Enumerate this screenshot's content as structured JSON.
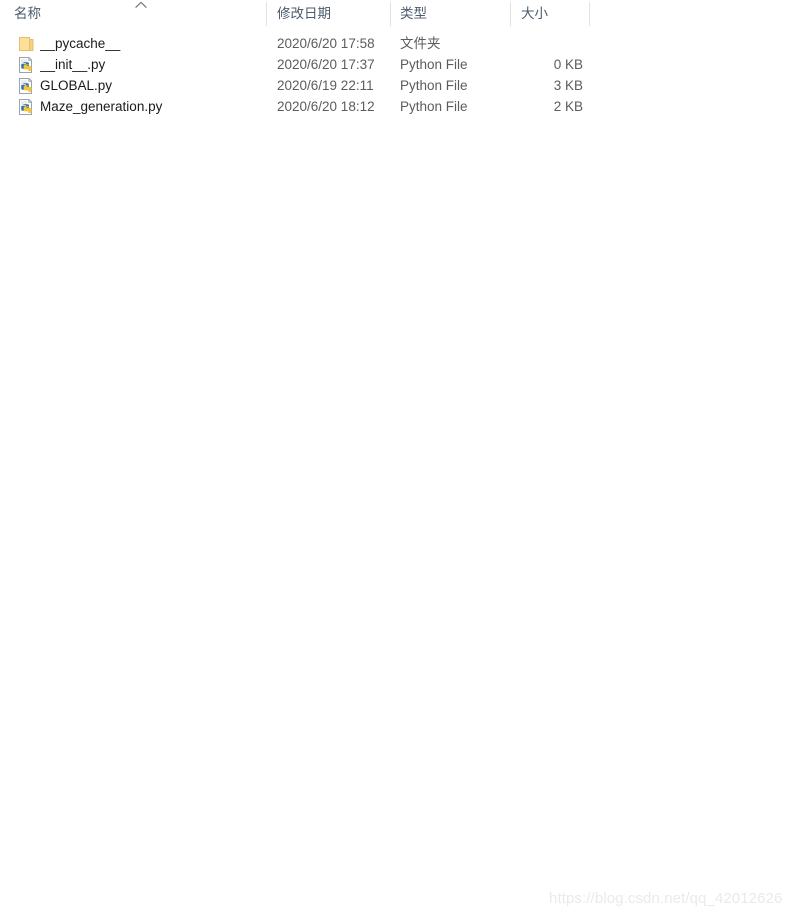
{
  "window": {
    "view": "details",
    "background_color": "#ffffff"
  },
  "columns": {
    "headers": [
      {
        "key": "name",
        "label": "名称",
        "sorted": true,
        "sort_direction": "ascending",
        "sort_icon": "chevron-up-icon"
      },
      {
        "key": "date_modified",
        "label": "修改日期",
        "sorted": false
      },
      {
        "key": "type",
        "label": "类型",
        "sorted": false
      },
      {
        "key": "size",
        "label": "大小",
        "sorted": false
      }
    ],
    "header_text_color": "#4d5b6e",
    "separator_color": "#e2e2e2"
  },
  "files": [
    {
      "name": "__pycache__",
      "date_modified": "2020/6/20 17:58",
      "type": "文件夹",
      "size": "",
      "icon": "folder-icon",
      "icon_color": "#f2d17c"
    },
    {
      "name": "__init__.py",
      "date_modified": "2020/6/20 17:37",
      "type": "Python File",
      "size": "0 KB",
      "icon": "python-file-icon",
      "icon_color": "#3572a5"
    },
    {
      "name": "GLOBAL.py",
      "date_modified": "2020/6/19 22:11",
      "type": "Python File",
      "size": "3 KB",
      "icon": "python-file-icon",
      "icon_color": "#3572a5"
    },
    {
      "name": "Maze_generation.py",
      "date_modified": "2020/6/20 18:12",
      "type": "Python File",
      "size": "2 KB",
      "icon": "python-file-icon",
      "icon_color": "#3572a5"
    }
  ],
  "watermark": {
    "text": "https://blog.csdn.net/qq_42012626",
    "color": "#eaeaea"
  }
}
